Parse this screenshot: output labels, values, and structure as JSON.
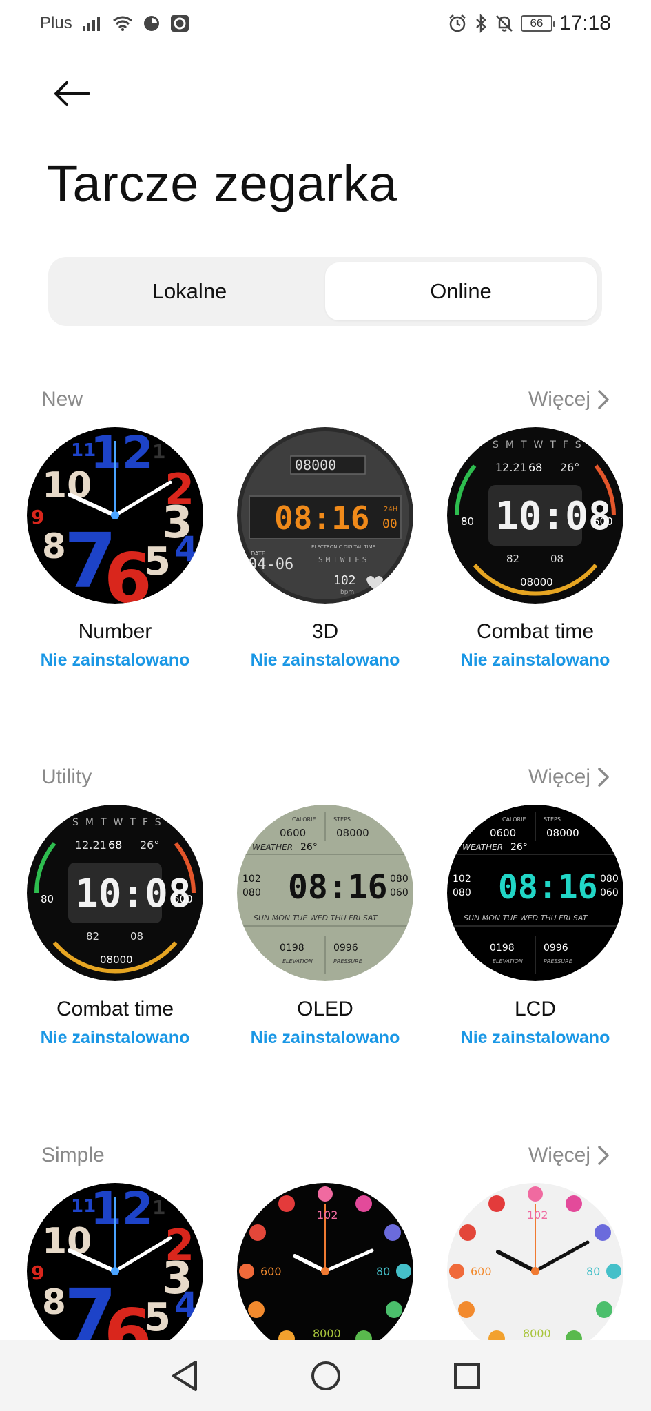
{
  "status_bar": {
    "carrier": "Plus",
    "battery": "66",
    "time": "17:18"
  },
  "header": {
    "title": "Tarcze zegarka"
  },
  "tabs": [
    {
      "label": "Lokalne",
      "active": false
    },
    {
      "label": "Online",
      "active": true
    }
  ],
  "more_label": "Więcej",
  "sections": [
    {
      "title": "New",
      "items": [
        {
          "name": "Number",
          "status": "Nie zainstalowano",
          "face": "number-face"
        },
        {
          "name": "3D",
          "status": "Nie zainstalowano",
          "face": "3d-face"
        },
        {
          "name": "Combat time",
          "status": "Nie zainstalowano",
          "face": "combat-time-face"
        }
      ]
    },
    {
      "title": "Utility",
      "items": [
        {
          "name": "Combat time",
          "status": "Nie zainstalowano",
          "face": "combat-time-face"
        },
        {
          "name": "OLED",
          "status": "Nie zainstalowano",
          "face": "oled-face"
        },
        {
          "name": "LCD",
          "status": "Nie zainstalowano",
          "face": "lcd-face"
        }
      ]
    },
    {
      "title": "Simple",
      "items": [
        {
          "name": "",
          "status": "",
          "face": "number-face"
        },
        {
          "name": "",
          "status": "",
          "face": "dots-dark-face"
        },
        {
          "name": "",
          "status": "",
          "face": "dots-light-face"
        }
      ]
    }
  ],
  "faces": {
    "threeD": {
      "top": "08000",
      "time": "08:16",
      "seconds": "00",
      "format": "24H",
      "date_label": "DATE",
      "date": "04-06",
      "caption": "ELECTRONIC DIGITAL TIME",
      "bpm_value": "102",
      "bpm": "bpm",
      "days": "SMTWTFS"
    },
    "combat": {
      "days": "SMTWTFS",
      "date": "12.21",
      "heart": "68",
      "temp": "26°",
      "time": "10:08",
      "left": "80",
      "right": "600",
      "a": "82",
      "b": "08",
      "steps": "08000"
    },
    "digital": {
      "calorie": "CALORIE",
      "steps_label": "STEPS",
      "cal_val": "0600",
      "steps_val": "08000",
      "weather": "WEATHER",
      "temp": "26°",
      "l1": "102",
      "l2": "080",
      "time": "08:16",
      "r1": "080",
      "r2": "060",
      "days": "SUN MON TUE WED THU FRI SAT",
      "elev_val": "0198",
      "press_val": "0996",
      "elev": "ELEVATION",
      "press": "PRESSURE"
    },
    "dots": {
      "top": "102",
      "left": "600",
      "right": "80",
      "bottom": "8000"
    },
    "number_digits": [
      "11",
      "12",
      "1",
      "2",
      "10",
      "9",
      "3",
      "8",
      "7",
      "6",
      "5",
      "4"
    ]
  }
}
